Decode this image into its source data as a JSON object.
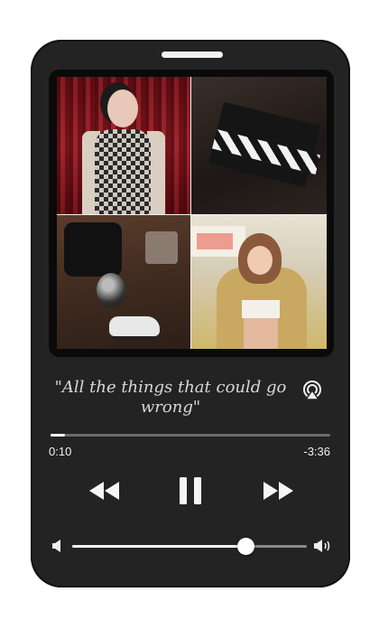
{
  "now_playing": {
    "title": "\"All the things that could go wrong\"",
    "elapsed": "0:10",
    "remaining": "-3:36",
    "progress_fraction": 0.05
  },
  "volume": {
    "level_fraction": 0.74
  },
  "icons": {
    "airplay": "airplay-icon",
    "rewind": "rewind-icon",
    "pause": "pause-icon",
    "forward": "fast-forward-icon",
    "volume_low": "volume-low-icon",
    "volume_high": "volume-high-icon"
  },
  "colors": {
    "phone_body": "#232323",
    "accent": "#f5f5f5",
    "track": "#6b6b6b"
  }
}
